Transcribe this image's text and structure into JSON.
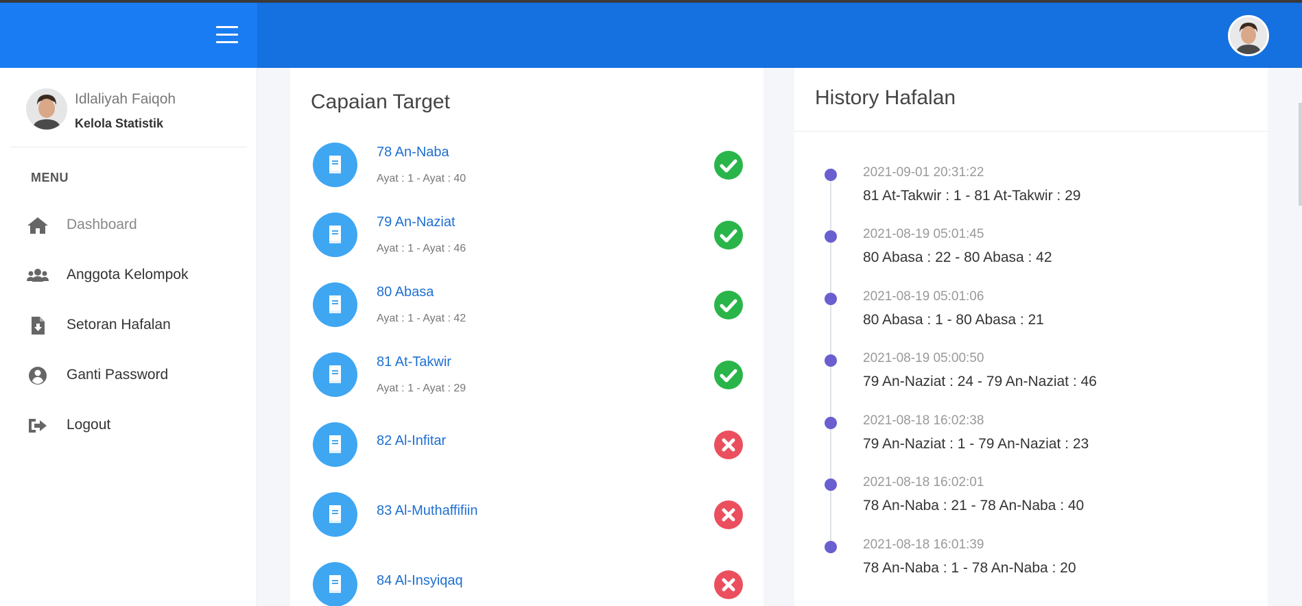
{
  "topbar": {
    "menu_icon": "hamburger-icon",
    "avatar_icon": "user-avatar"
  },
  "sidebar": {
    "user_name": "Idlaliyah Faiqoh",
    "user_role": "Kelola Statistik",
    "menu_header": "MENU",
    "items": [
      {
        "label": "Dashboard",
        "icon": "home-icon",
        "active": true
      },
      {
        "label": "Anggota Kelompok",
        "icon": "users-icon"
      },
      {
        "label": "Setoran Hafalan",
        "icon": "file-download-icon"
      },
      {
        "label": "Ganti Password",
        "icon": "user-circle-icon"
      },
      {
        "label": "Logout",
        "icon": "sign-out-icon"
      }
    ]
  },
  "target": {
    "title": "Capaian Target",
    "items": [
      {
        "surah": "78 An-Naba",
        "ayat": "Ayat : 1 - Ayat : 40",
        "done": true
      },
      {
        "surah": "79 An-Naziat",
        "ayat": "Ayat : 1 - Ayat : 46",
        "done": true
      },
      {
        "surah": "80 Abasa",
        "ayat": "Ayat : 1 - Ayat : 42",
        "done": true
      },
      {
        "surah": "81 At-Takwir",
        "ayat": "Ayat : 1 - Ayat : 29",
        "done": true
      },
      {
        "surah": "82 Al-Infitar",
        "ayat": "",
        "done": false
      },
      {
        "surah": "83 Al-Muthaffifiin",
        "ayat": "",
        "done": false
      },
      {
        "surah": "84 Al-Insyiqaq",
        "ayat": "",
        "done": false
      }
    ]
  },
  "history": {
    "title": "History Hafalan",
    "items": [
      {
        "date": "2021-09-01 20:31:22",
        "text": "81 At-Takwir : 1 - 81 At-Takwir : 29"
      },
      {
        "date": "2021-08-19 05:01:45",
        "text": "80 Abasa : 22 - 80 Abasa : 42"
      },
      {
        "date": "2021-08-19 05:01:06",
        "text": "80 Abasa : 1 - 80 Abasa : 21"
      },
      {
        "date": "2021-08-19 05:00:50",
        "text": "79 An-Naziat : 24 - 79 An-Naziat : 46"
      },
      {
        "date": "2021-08-18 16:02:38",
        "text": "79 An-Naziat : 1 - 79 An-Naziat : 23"
      },
      {
        "date": "2021-08-18 16:02:01",
        "text": "78 An-Naba : 21 - 78 An-Naba : 40"
      },
      {
        "date": "2021-08-18 16:01:39",
        "text": "78 An-Naba : 1 - 78 An-Naba : 20"
      }
    ]
  },
  "colors": {
    "topbar": "#1570e0",
    "brand": "#1a7cf2",
    "book_circle": "#3fa6f2",
    "done": "#29b54a",
    "todo": "#eb4f5e",
    "timeline_dot": "#6a5fcf",
    "link": "#1e6fd1"
  }
}
